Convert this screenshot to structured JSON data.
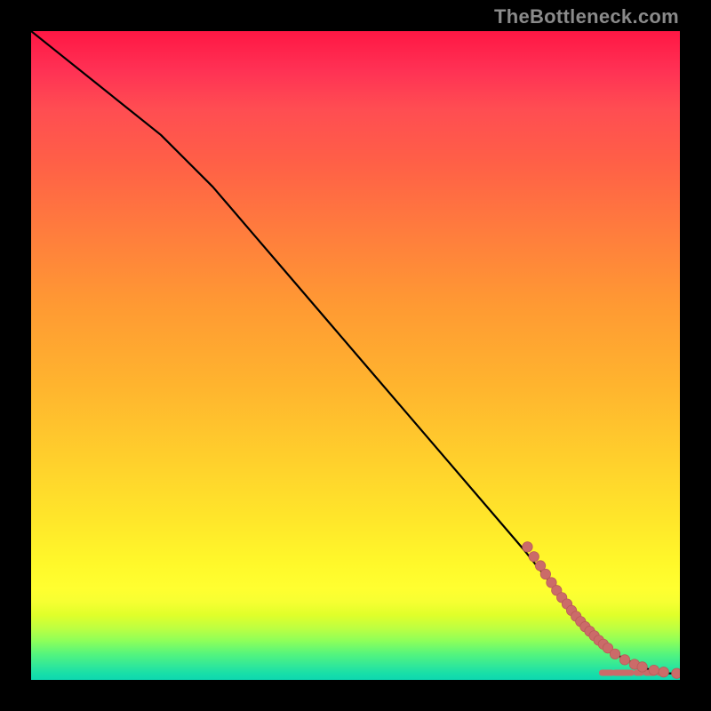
{
  "watermark": "TheBottleneck.com",
  "colors": {
    "page_bg": "#000000",
    "curve": "#000000",
    "dot_fill": "#cb6b69",
    "dot_stroke": "#b95b58",
    "gradient_top": "#ff1744",
    "gradient_bottom": "#0ed8b0"
  },
  "chart_data": {
    "type": "line",
    "title": "",
    "xlabel": "",
    "ylabel": "",
    "xlim": [
      0,
      100
    ],
    "ylim": [
      0,
      100
    ],
    "grid": false,
    "legend": false,
    "series": [
      {
        "name": "curve",
        "x": [
          0,
          5,
          10,
          15,
          20,
          24,
          28,
          34,
          40,
          46,
          52,
          58,
          64,
          70,
          76,
          80,
          83,
          86,
          88,
          90,
          92,
          94,
          96,
          98,
          100
        ],
        "y": [
          100,
          96,
          92,
          88,
          84,
          80,
          76,
          69,
          62,
          55,
          48,
          41,
          34,
          27,
          20,
          15,
          11,
          8,
          6,
          4,
          3,
          2,
          1.4,
          1,
          1
        ]
      }
    ],
    "points": {
      "name": "dots",
      "x": [
        76.5,
        77.5,
        78.5,
        79.3,
        80.2,
        81.0,
        81.8,
        82.6,
        83.3,
        84.0,
        84.7,
        85.4,
        86.1,
        86.8,
        87.5,
        88.2,
        88.9,
        90.0,
        91.5,
        93.0,
        94.2,
        96.0,
        97.5,
        99.5
      ],
      "y": [
        20.5,
        19.0,
        17.6,
        16.3,
        15.0,
        13.8,
        12.7,
        11.7,
        10.7,
        9.8,
        9.0,
        8.2,
        7.5,
        6.8,
        6.1,
        5.5,
        4.9,
        4.0,
        3.1,
        2.4,
        2.0,
        1.5,
        1.2,
        1.0
      ]
    },
    "dashes": {
      "name": "floor-dashes",
      "segments": [
        {
          "x0": 88.0,
          "x1": 89.5,
          "y": 1.1
        },
        {
          "x0": 90.0,
          "x1": 92.5,
          "y": 1.1
        },
        {
          "x0": 93.3,
          "x1": 94.0,
          "y": 1.1
        },
        {
          "x0": 94.8,
          "x1": 96.0,
          "y": 1.1
        },
        {
          "x0": 96.8,
          "x1": 97.2,
          "y": 1.1
        }
      ]
    }
  }
}
